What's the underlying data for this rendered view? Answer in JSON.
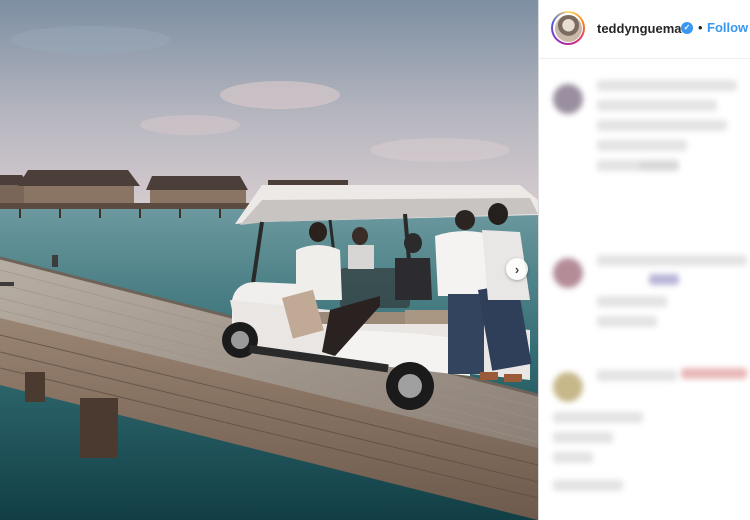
{
  "post": {
    "username": "teddynguema",
    "separator": "•",
    "follow_label": "Follow",
    "verified_icon": "verified-badge-icon",
    "carousel_icon": "chevron-right-icon"
  },
  "comments_blurred": true
}
